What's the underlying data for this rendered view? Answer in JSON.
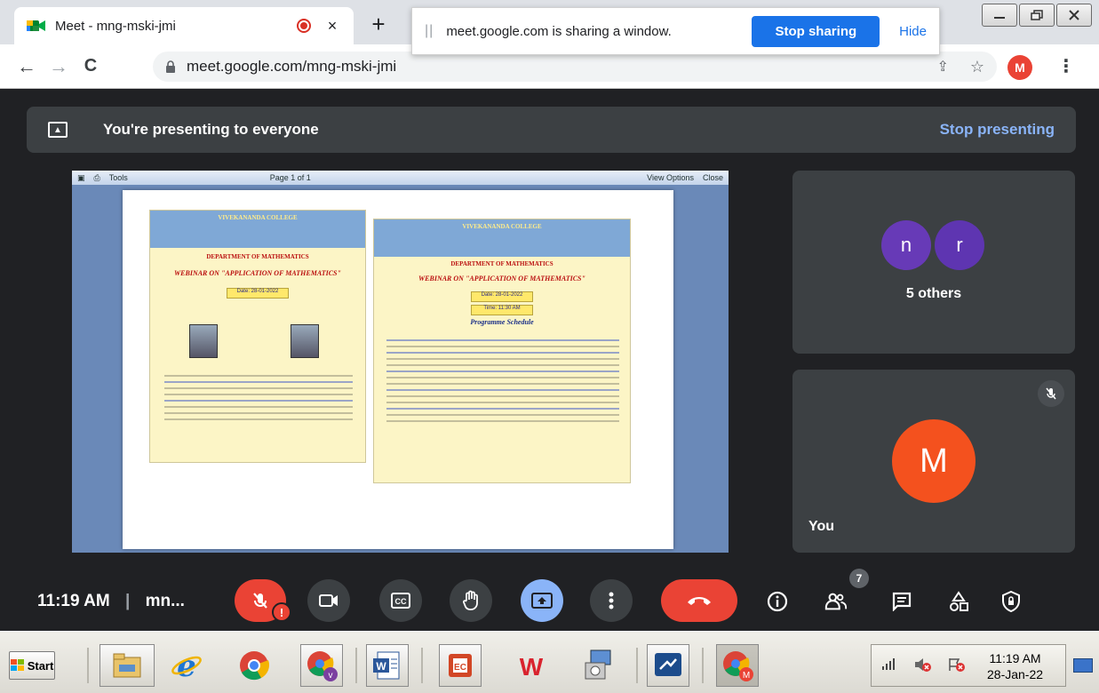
{
  "browser": {
    "tab_title": "Meet - mng-mski-jmi",
    "tab_close": "×",
    "new_tab": "+",
    "address": "meet.google.com/mng-mski-jmi",
    "profile_initial": "M"
  },
  "share_bar": {
    "message": "meet.google.com is sharing a window.",
    "stop_button": "Stop sharing",
    "hide_link": "Hide"
  },
  "meet": {
    "banner_text": "You're presenting to everyone",
    "stop_presenting": "Stop presenting",
    "participants_tile": {
      "avatars": [
        {
          "initial": "n",
          "color": "#673ab7"
        },
        {
          "initial": "r",
          "color": "#5e35b1"
        }
      ],
      "label": "5 others"
    },
    "self_tile": {
      "initial": "M",
      "color": "#f4511e",
      "label": "You"
    },
    "shared_doc": {
      "viewer_tools": "Tools",
      "page_indicator": "Page 1 of 1",
      "view_options": "View Options",
      "close": "Close",
      "flyer_left": {
        "college": "VIVEKANANDA COLLEGE",
        "dept": "DEPARTMENT OF MATHEMATICS",
        "webinar": "WEBINAR ON \"APPLICATION OF MATHEMATICS\"",
        "date": "Date: 28-01-2022"
      },
      "flyer_right": {
        "college": "VIVEKANANDA COLLEGE",
        "dept": "DEPARTMENT OF MATHEMATICS",
        "webinar": "WEBINAR ON \"APPLICATION OF MATHEMATICS\"",
        "date": "Date: 28-01-2022",
        "time": "Time: 11:30 AM",
        "schedule": "Programme Schedule"
      }
    }
  },
  "controls": {
    "time": "11:19 AM",
    "meeting_code": "mn...",
    "people_count": "7"
  },
  "taskbar": {
    "start_label": "Start",
    "tray_time": "11:19 AM",
    "tray_date": "28-Jan-22"
  },
  "colors": {
    "meet_bg": "#202124",
    "tile_bg": "#3c4043",
    "accent_blue": "#1a73e8",
    "hangup_red": "#ea4335",
    "present_blue": "#8ab4f8"
  }
}
